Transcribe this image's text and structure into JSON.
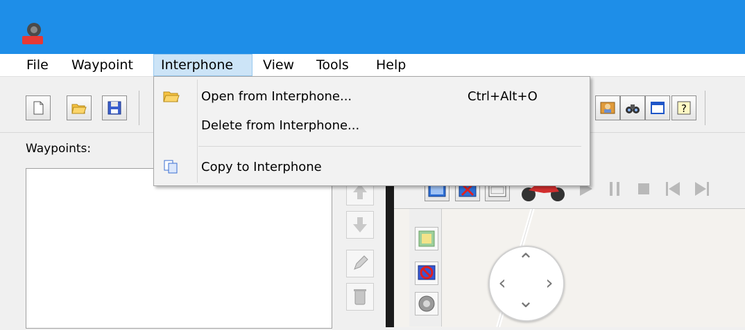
{
  "menubar": {
    "items": [
      {
        "label": "File"
      },
      {
        "label": "Waypoint"
      },
      {
        "label": "Interphone"
      },
      {
        "label": "View"
      },
      {
        "label": "Tools"
      },
      {
        "label": "Help"
      }
    ]
  },
  "dropdown": {
    "items": [
      {
        "label": "Open from Interphone...",
        "shortcut": "Ctrl+Alt+O",
        "icon": "open-folder-icon"
      },
      {
        "label": "Delete from Interphone...",
        "shortcut": "",
        "icon": ""
      },
      {
        "label": "Copy to Interphone",
        "shortcut": "",
        "icon": "copy-icon"
      }
    ]
  },
  "waypoints_panel": {
    "label": "Waypoints:",
    "items": []
  },
  "colors": {
    "titlebar": "#1e8ee8",
    "menu_highlight": "#cce4f7",
    "map_background": "#f4f2ee"
  }
}
